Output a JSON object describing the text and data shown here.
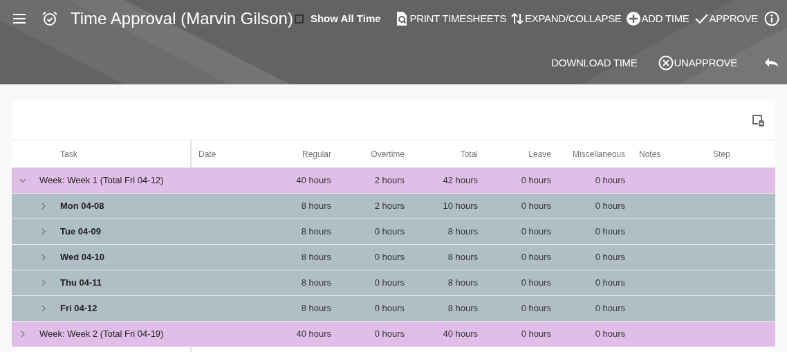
{
  "header": {
    "title": "Time Approval (Marvin Gilson)",
    "show_all_time": {
      "label": "Show All Time",
      "checked": false
    },
    "actions": [
      {
        "kind": "print",
        "label": "PRINT TIMESHEETS"
      },
      {
        "kind": "expand",
        "label": "EXPAND/COLLAPSE"
      },
      {
        "kind": "add",
        "label": "ADD TIME"
      },
      {
        "kind": "approve",
        "label": "APPROVE"
      },
      {
        "kind": "info"
      }
    ],
    "actions_row_2": [
      {
        "kind": "plain",
        "label": "DOWNLOAD TIME"
      },
      {
        "kind": "unapprove",
        "label": "UNAPPROVE"
      },
      {
        "kind": "undo"
      }
    ]
  },
  "table": {
    "columns": [
      "Task",
      "Date",
      "Regular",
      "Overtime",
      "Total",
      "Leave",
      "Miscellaneous",
      "Notes",
      "Step"
    ],
    "rows": [
      {
        "task": "Week: Week 1 (Total Fri 04-12)",
        "regular": "40 hours",
        "overtime": "2 hours",
        "total": "42 hours",
        "leave": "0 hours",
        "misc": "0 hours",
        "expanded": true,
        "children": [
          {
            "task": "Mon 04-08",
            "regular": "8 hours",
            "overtime": "2 hours",
            "total": "10 hours",
            "leave": "0 hours",
            "misc": "0 hours",
            "expanded": false
          },
          {
            "task": "Tue 04-09",
            "regular": "8 hours",
            "overtime": "0 hours",
            "total": "8 hours",
            "leave": "0 hours",
            "misc": "0 hours",
            "expanded": false
          },
          {
            "task": "Wed 04-10",
            "regular": "8 hours",
            "overtime": "0 hours",
            "total": "8 hours",
            "leave": "0 hours",
            "misc": "0 hours",
            "expanded": false
          },
          {
            "task": "Thu 04-11",
            "regular": "8 hours",
            "overtime": "0 hours",
            "total": "8 hours",
            "leave": "0 hours",
            "misc": "0 hours",
            "expanded": false
          },
          {
            "task": "Fri 04-12",
            "regular": "8 hours",
            "overtime": "0 hours",
            "total": "8 hours",
            "leave": "0 hours",
            "misc": "0 hours",
            "expanded": false
          }
        ]
      },
      {
        "task": "Week: Week 2 (Total Fri 04-19)",
        "regular": "40 hours",
        "overtime": "0 hours",
        "total": "40 hours",
        "leave": "0 hours",
        "misc": "0 hours",
        "expanded": false
      }
    ]
  }
}
